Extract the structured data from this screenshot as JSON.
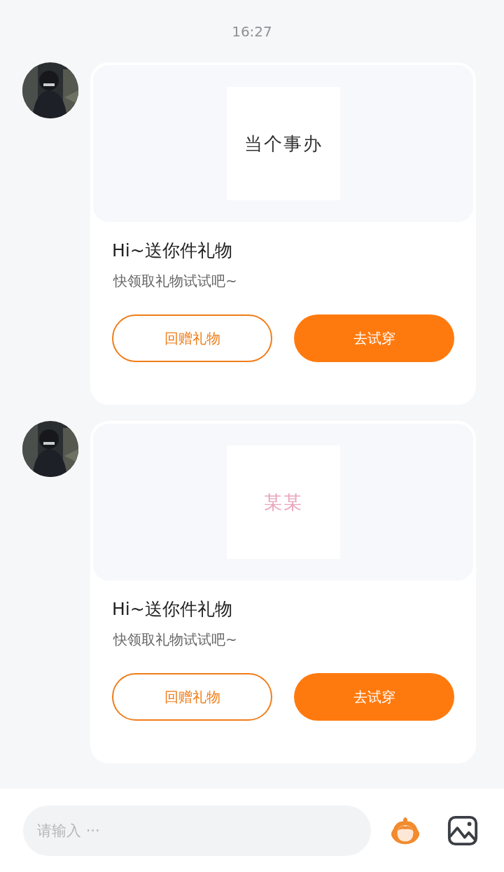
{
  "time": "16:27",
  "messages": [
    {
      "gift": {
        "text": "当个事办",
        "color": "#333333"
      },
      "title": "Hi~送你件礼物",
      "subtitle": "快领取礼物试试吧~",
      "buttons": [
        {
          "label": "回赠礼物",
          "kind": "outline"
        },
        {
          "label": "去试穿",
          "kind": "filled"
        }
      ]
    },
    {
      "gift": {
        "text": "某某",
        "color": "#e9a6bb"
      },
      "title": "Hi~送你件礼物",
      "subtitle": "快领取礼物试试吧~",
      "buttons": [
        {
          "label": "回赠礼物",
          "kind": "outline"
        },
        {
          "label": "去试穿",
          "kind": "filled"
        }
      ]
    }
  ],
  "input": {
    "placeholder": "请输入 ···"
  }
}
